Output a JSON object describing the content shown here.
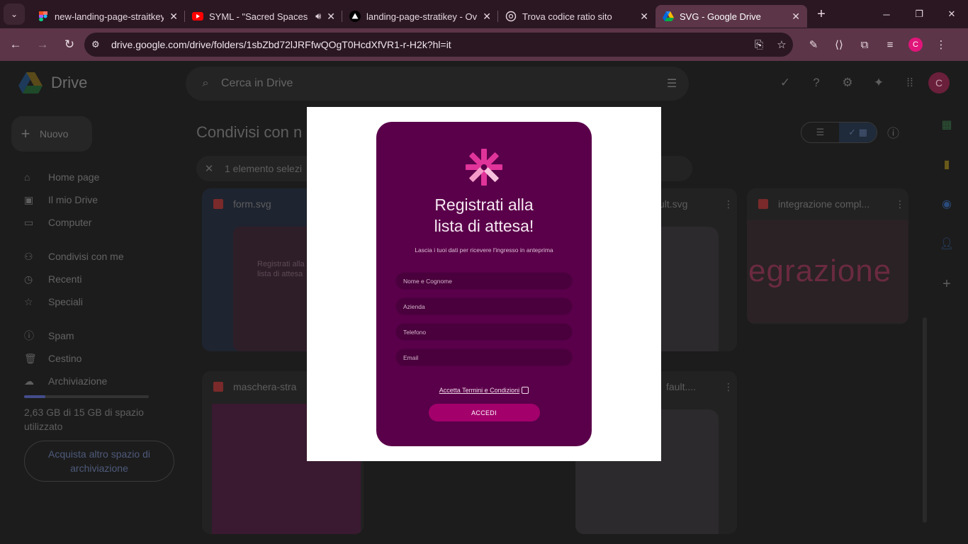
{
  "browser": {
    "tabs": [
      {
        "title": "new-landing-page-straitkey",
        "icon": "figma-icon"
      },
      {
        "title": "SYML - \"Sacred Spaces -",
        "icon": "youtube-icon",
        "audio": true
      },
      {
        "title": "landing-page-stratikey - Ove",
        "icon": "vercel-icon"
      },
      {
        "title": "Trova codice ratio sito",
        "icon": "chatgpt-icon"
      },
      {
        "title": "SVG - Google Drive",
        "icon": "drive-icon",
        "active": true
      }
    ],
    "url": "drive.google.com/drive/folders/1sbZbd72lJRFfwQOgT0HcdXfVR1-r-H2k?hl=it",
    "profile_initial": "C"
  },
  "drive": {
    "app_name": "Drive",
    "search_placeholder": "Cerca in Drive",
    "new_label": "Nuovo",
    "nav": [
      "Home page",
      "Il mio Drive",
      "Computer",
      "Condivisi con me",
      "Recenti",
      "Speciali",
      "Spam",
      "Cestino",
      "Archiviazione"
    ],
    "storage_text": "2,63 GB di 15 GB di spazio utilizzato",
    "buy_storage": "Acquista altro spazio di archiviazione",
    "page_title": "Condivisi con n",
    "selection_text": "1 elemento selezi",
    "avatar_initial": "C",
    "files": [
      {
        "name": "form.svg"
      },
      {
        "name": "ult.svg"
      },
      {
        "name": "integrazione compl..."
      },
      {
        "name": "maschera-stra"
      },
      {
        "name": "fault...."
      }
    ],
    "thumb_text": {
      "form_title": "Registrati alla lista di attesa",
      "integrazione": "egrazione"
    }
  },
  "preview": {
    "heading": "Registrati alla\nlista di attesa!",
    "subtitle": "Lascia i tuoi dati per ricevere l'ingresso in anteprima",
    "fields": [
      "Nome e Cognome",
      "Azienda",
      "Telefono",
      "Email"
    ],
    "terms": "Accetta Termini e Condizioni",
    "button": "ACCEDI",
    "colors": {
      "card": "#5a004a",
      "button": "#a3006c",
      "logo": "#e0349a"
    }
  }
}
